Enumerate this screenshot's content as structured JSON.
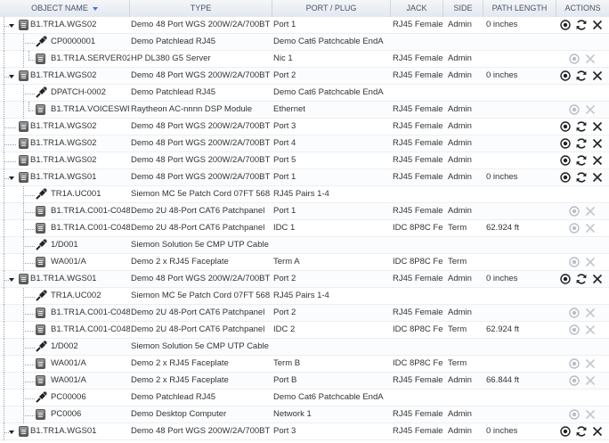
{
  "columns": [
    {
      "label": "OBJECT NAME",
      "sorted": true
    },
    {
      "label": "TYPE"
    },
    {
      "label": "PORT / PLUG"
    },
    {
      "label": "JACK"
    },
    {
      "label": "SIDE"
    },
    {
      "label": "PATH LENGTH"
    },
    {
      "label": "ACTIONS"
    }
  ],
  "rows": [
    {
      "depth": 0,
      "icon": "device-icon",
      "expanded": true,
      "name": "B1.TR1A.WGS02",
      "type": "Demo 48 Port WGS 200W/2A/700BT",
      "port": "Port 1",
      "jack": "RJ45 Female",
      "side": "Admin",
      "path": "0 inches",
      "actions": "full"
    },
    {
      "depth": 1,
      "icon": "cable-icon",
      "name": "CP0000001",
      "type": "Demo Patchlead RJ45",
      "port": "Demo Cat6 Patchcable EndA",
      "jack": "",
      "side": "",
      "path": "",
      "actions": "none"
    },
    {
      "depth": 2,
      "icon": "device-icon",
      "name": "B1.TR1A.SERVER02",
      "type": "HP DL380 G5 Server",
      "port": "Nic 1",
      "jack": "RJ45 Female",
      "side": "Admin",
      "path": "",
      "actions": "view-disabled"
    },
    {
      "depth": 0,
      "icon": "device-icon",
      "expanded": true,
      "name": "B1.TR1A.WGS02",
      "type": "Demo 48 Port WGS 200W/2A/700BT",
      "port": "Port 2",
      "jack": "RJ45 Female",
      "side": "Admin",
      "path": "0 inches",
      "actions": "full"
    },
    {
      "depth": 1,
      "icon": "cable-icon",
      "name": "DPATCH-0002",
      "type": "Demo Patchlead RJ45",
      "port": "Demo Cat6 Patchcable EndA",
      "jack": "",
      "side": "",
      "path": "",
      "actions": "none"
    },
    {
      "depth": 2,
      "icon": "device-icon",
      "name": "B1.TR1A.VOICESWITCH",
      "type": "Raytheon AC-nnnn DSP Module",
      "port": "Ethernet",
      "jack": "RJ45 Female",
      "side": "Admin",
      "path": "",
      "actions": "view-disabled"
    },
    {
      "depth": 0,
      "icon": "device-icon",
      "name": "B1.TR1A.WGS02",
      "type": "Demo 48 Port WGS 200W/2A/700BT",
      "port": "Port 3",
      "jack": "RJ45 Female",
      "side": "Admin",
      "path": "",
      "actions": "full"
    },
    {
      "depth": 0,
      "icon": "device-icon",
      "name": "B1.TR1A.WGS02",
      "type": "Demo 48 Port WGS 200W/2A/700BT",
      "port": "Port 4",
      "jack": "RJ45 Female",
      "side": "Admin",
      "path": "",
      "actions": "full"
    },
    {
      "depth": 0,
      "icon": "device-icon",
      "name": "B1.TR1A.WGS02",
      "type": "Demo 48 Port WGS 200W/2A/700BT",
      "port": "Port 5",
      "jack": "RJ45 Female",
      "side": "Admin",
      "path": "",
      "actions": "full"
    },
    {
      "depth": 0,
      "icon": "device-icon",
      "expanded": true,
      "name": "B1.TR1A.WGS01",
      "type": "Demo 48 Port WGS 200W/2A/700BT",
      "port": "Port 1",
      "jack": "RJ45 Female",
      "side": "Admin",
      "path": "0 inches",
      "actions": "full"
    },
    {
      "depth": 1,
      "icon": "cable-icon",
      "name": "TR1A.UC001",
      "type": "Siemon MC 5e Patch Cord 07FT 568",
      "port": "RJ45 Pairs 1-4",
      "jack": "",
      "side": "",
      "path": "",
      "actions": "none"
    },
    {
      "depth": 1,
      "icon": "device-icon",
      "name": "B1.TR1A.C001-C048",
      "type": "Demo 2U 48-Port CAT6 Patchpanel",
      "port": "Port 1",
      "jack": "RJ45 Female",
      "side": "Admin",
      "path": "",
      "actions": "view-disabled"
    },
    {
      "depth": 1,
      "icon": "device-icon",
      "name": "B1.TR1A.C001-C048",
      "type": "Demo 2U 48-Port CAT6 Patchpanel",
      "port": "IDC 1",
      "jack": "IDC 8P8C Female",
      "side": "Term",
      "path": "62.924 ft",
      "actions": "view-disabled"
    },
    {
      "depth": 1,
      "icon": "cable-icon",
      "name": "1/D001",
      "type": "Siemon Solution 5e CMP UTP Cable",
      "port": "",
      "jack": "",
      "side": "",
      "path": "",
      "actions": "none"
    },
    {
      "depth": 1,
      "icon": "device-icon",
      "name": "WA001/A",
      "type": "Demo 2 x RJ45 Faceplate",
      "port": "Term A",
      "jack": "IDC 8P8C Female",
      "side": "Term",
      "path": "",
      "actions": "view-disabled"
    },
    {
      "depth": 0,
      "icon": "device-icon",
      "expanded": true,
      "name": "B1.TR1A.WGS01",
      "type": "Demo 48 Port WGS 200W/2A/700BT",
      "port": "Port 2",
      "jack": "RJ45 Female",
      "side": "Admin",
      "path": "0 inches",
      "actions": "full"
    },
    {
      "depth": 1,
      "icon": "cable-icon",
      "name": "TR1A.UC002",
      "type": "Siemon MC 5e Patch Cord 07FT 568",
      "port": "RJ45 Pairs 1-4",
      "jack": "",
      "side": "",
      "path": "",
      "actions": "none"
    },
    {
      "depth": 1,
      "icon": "device-icon",
      "name": "B1.TR1A.C001-C048",
      "type": "Demo 2U 48-Port CAT6 Patchpanel",
      "port": "Port 2",
      "jack": "RJ45 Female",
      "side": "Admin",
      "path": "",
      "actions": "view-disabled"
    },
    {
      "depth": 1,
      "icon": "device-icon",
      "name": "B1.TR1A.C001-C048",
      "type": "Demo 2U 48-Port CAT6 Patchpanel",
      "port": "IDC 2",
      "jack": "IDC 8P8C Female",
      "side": "Term",
      "path": "62.924 ft",
      "actions": "view-disabled"
    },
    {
      "depth": 1,
      "icon": "cable-icon",
      "name": "1/D002",
      "type": "Siemon Solution 5e CMP UTP Cable",
      "port": "",
      "jack": "",
      "side": "",
      "path": "",
      "actions": "none"
    },
    {
      "depth": 1,
      "icon": "device-icon",
      "name": "WA001/A",
      "type": "Demo 2 x RJ45 Faceplate",
      "port": "Term B",
      "jack": "IDC 8P8C Female",
      "side": "Term",
      "path": "",
      "actions": "view-disabled"
    },
    {
      "depth": 1,
      "icon": "device-icon",
      "name": "WA001/A",
      "type": "Demo 2 x RJ45 Faceplate",
      "port": "Port B",
      "jack": "RJ45 Female",
      "side": "Admin",
      "path": "66.844 ft",
      "actions": "view-disabled"
    },
    {
      "depth": 1,
      "icon": "cable-icon",
      "name": "PC00006",
      "type": "Demo Patchlead RJ45",
      "port": "Demo Cat6 Patchcable EndA",
      "jack": "",
      "side": "",
      "path": "",
      "actions": "none"
    },
    {
      "depth": 1,
      "icon": "device-icon",
      "name": "PC0006",
      "type": "Demo Desktop Computer",
      "port": "Network 1",
      "jack": "RJ45 Female",
      "side": "Admin",
      "path": "",
      "actions": "view-disabled"
    },
    {
      "depth": 0,
      "icon": "device-icon",
      "expanded": true,
      "name": "B1.TR1A.WGS01",
      "type": "Demo 48 Port WGS 200W/2A/700BT",
      "port": "Port 3",
      "jack": "RJ45 Female",
      "side": "Admin",
      "path": "0 inches",
      "actions": "full"
    }
  ]
}
